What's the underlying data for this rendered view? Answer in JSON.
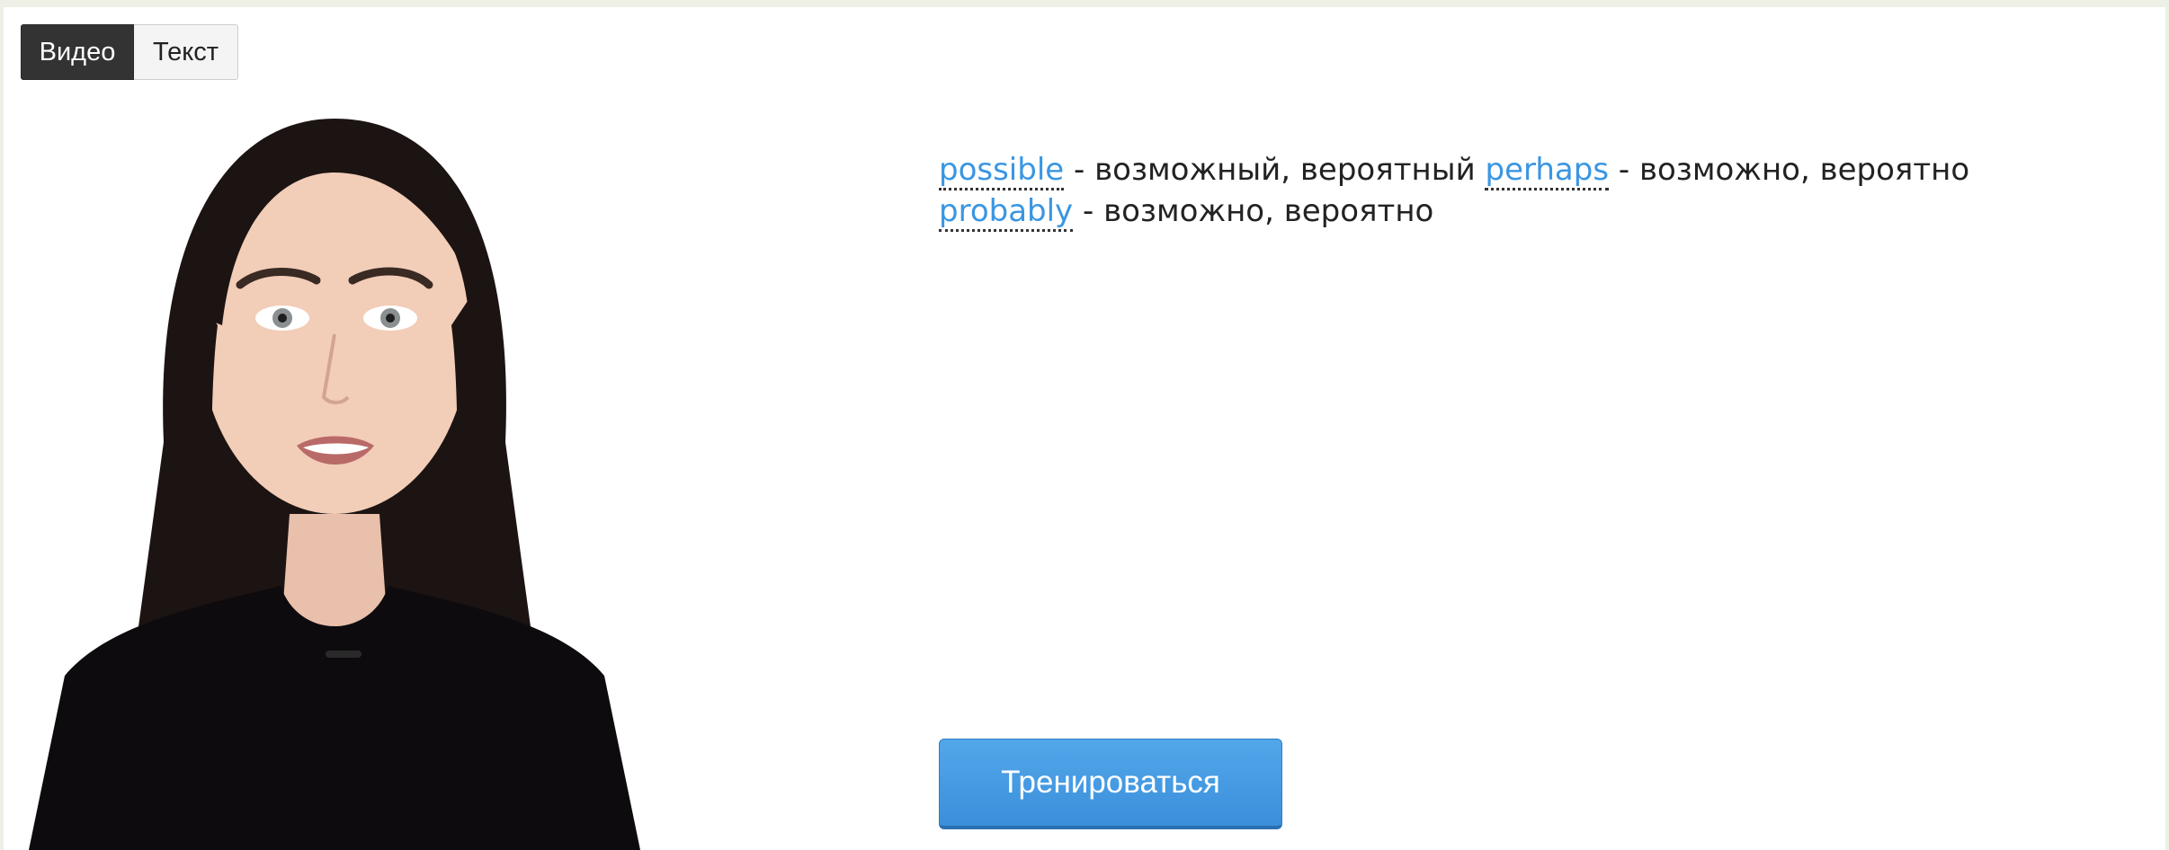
{
  "tabs": [
    {
      "label": "Видео",
      "active": true
    },
    {
      "label": "Текст",
      "active": false
    }
  ],
  "vocabulary": [
    {
      "word": "possible",
      "translation": "возможный, вероятный"
    },
    {
      "word": "perhaps",
      "translation": "возможно, вероятно"
    },
    {
      "word": "probably",
      "translation": "возможно, вероятно"
    }
  ],
  "separator": " - ",
  "train_button": {
    "label": "Тренироваться"
  },
  "colors": {
    "accent": "#3a96e2",
    "tab_active_bg": "#333333",
    "page_bg": "#eef0e6"
  },
  "video": {
    "icon": "presenter-video-frame"
  }
}
